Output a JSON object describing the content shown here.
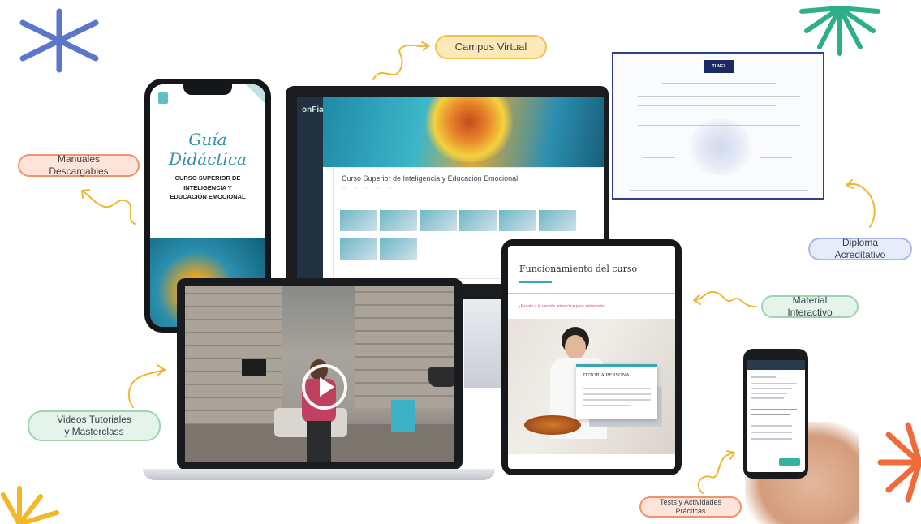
{
  "labels": {
    "campus_virtual": "Campus Virtual",
    "manuales": "Manuales Descargables",
    "diploma": "Diploma Acreditativo",
    "material": "Material Interactivo",
    "videos_line1": "Videos Tutoriales",
    "videos_line2": "y Masterclass",
    "tests": "Tests y Actividades Prácticas"
  },
  "phone": {
    "script_title": "Guía Didáctica",
    "course_line1": "CURSO SUPERIOR DE INTELIGENCIA Y",
    "course_line2": "EDUCACIÓN EMOCIONAL"
  },
  "lms": {
    "logo": "onFia",
    "course_title": "Curso Superior de Inteligencia y Educación Emocional"
  },
  "tablet": {
    "title": "Funcionamiento del curso",
    "note": "¡Pasate a la versión interactiva para saber más!",
    "popup_title": "TUTORÍA PERSONAL"
  },
  "certificate": {
    "logo": "TUNEZ"
  },
  "colors": {
    "burst_blue": "#5a77c9",
    "burst_green": "#2fae8a",
    "burst_orange": "#f06a3c",
    "burst_yellow": "#f3b829",
    "arrow": "#f2b632"
  }
}
